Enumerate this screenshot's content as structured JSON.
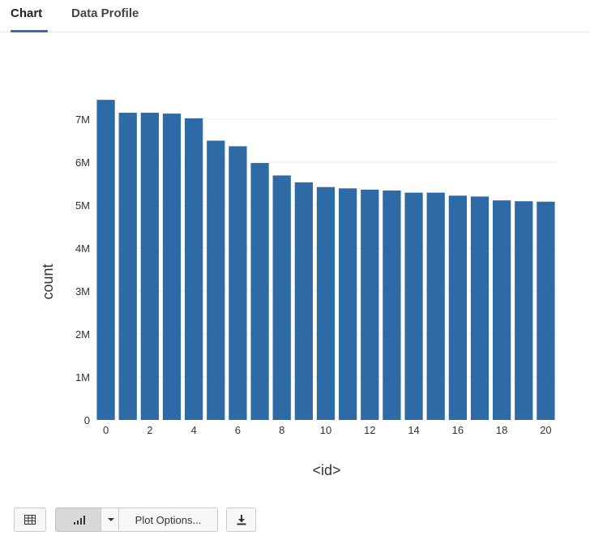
{
  "tabs": [
    {
      "label": "Chart",
      "active": true
    },
    {
      "label": "Data Profile",
      "active": false
    }
  ],
  "toolbar": {
    "table_icon": "table-icon",
    "chart_icon": "bar-chart-icon",
    "dropdown_icon": "caret-down-icon",
    "plot_options_label": "Plot Options...",
    "download_icon": "download-icon"
  },
  "colors": {
    "bar": "#2e6aa6",
    "accent": "#2f6fb5",
    "grid": "#ececec"
  },
  "chart_data": {
    "type": "bar",
    "xlabel": "<id>",
    "ylabel": "count",
    "x": [
      0,
      1,
      2,
      3,
      4,
      5,
      6,
      7,
      8,
      9,
      10,
      11,
      12,
      13,
      14,
      15,
      16,
      17,
      18,
      19,
      20
    ],
    "values": [
      7450000,
      7150000,
      7150000,
      7130000,
      7020000,
      6500000,
      6370000,
      5980000,
      5690000,
      5530000,
      5420000,
      5390000,
      5360000,
      5340000,
      5290000,
      5290000,
      5220000,
      5200000,
      5110000,
      5090000,
      5080000
    ],
    "ylim": [
      0,
      7500000
    ],
    "yticks": [
      0,
      1000000,
      2000000,
      3000000,
      4000000,
      5000000,
      6000000,
      7000000
    ],
    "ytick_labels": [
      "0",
      "1M",
      "2M",
      "3M",
      "4M",
      "5M",
      "6M",
      "7M"
    ],
    "xticks": [
      0,
      2,
      4,
      6,
      8,
      10,
      12,
      14,
      16,
      18,
      20
    ],
    "xtick_labels": [
      "0",
      "2",
      "4",
      "6",
      "8",
      "10",
      "12",
      "14",
      "16",
      "18",
      "20"
    ],
    "grid": true
  }
}
